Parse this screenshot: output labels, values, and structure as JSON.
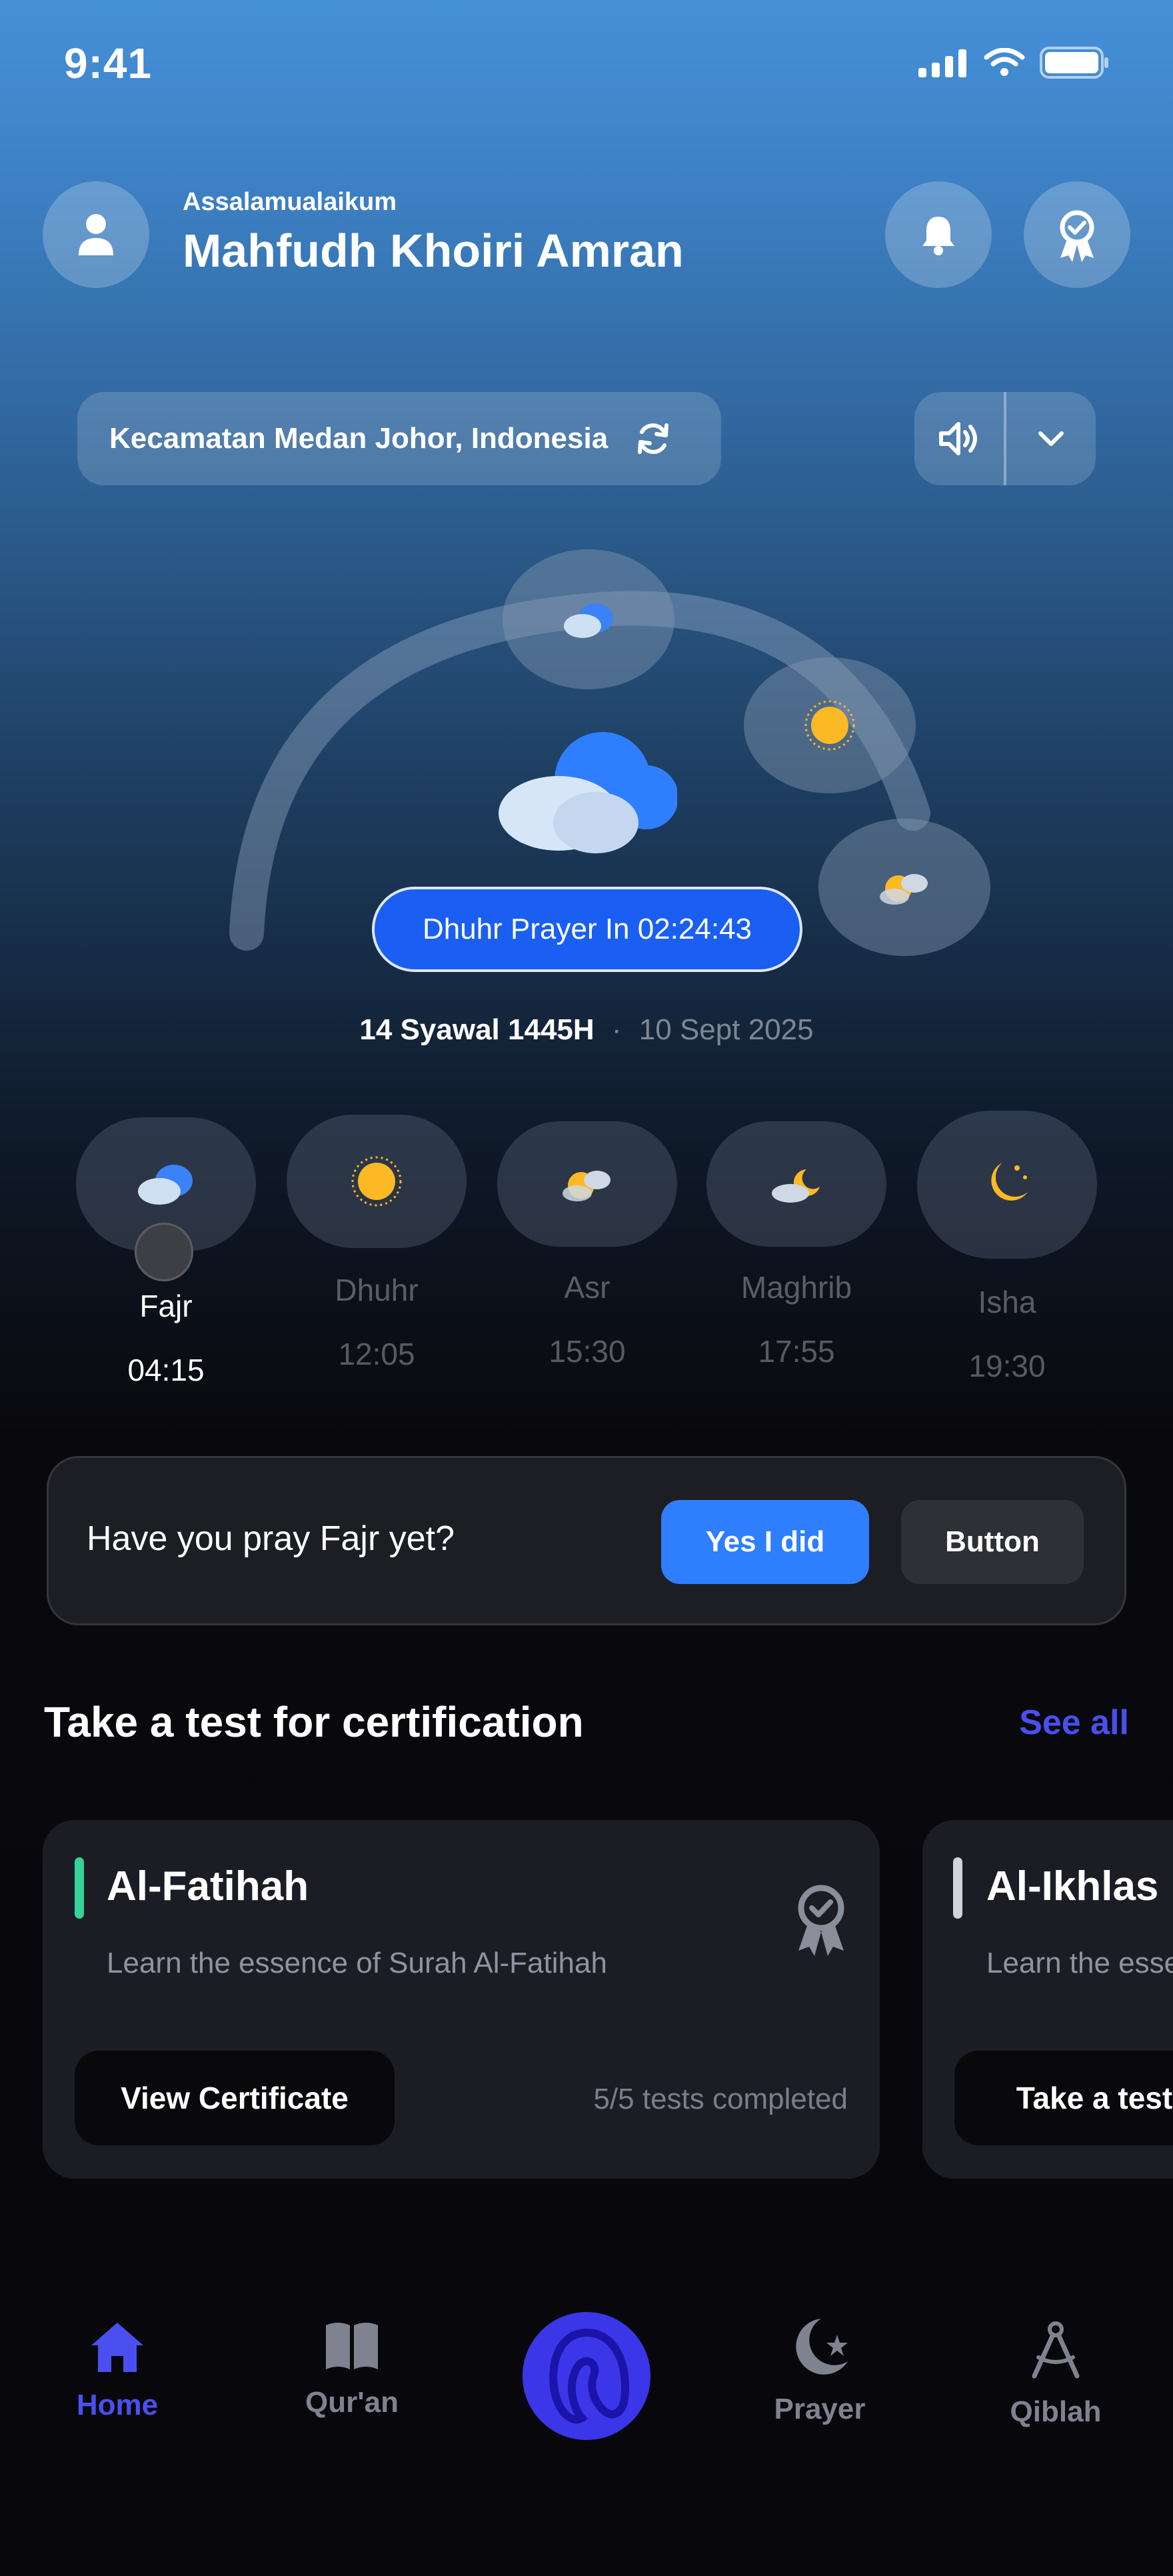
{
  "status_bar": {
    "time": "9:41",
    "signal_icon": "signal-bars-icon",
    "wifi_icon": "wifi-icon",
    "battery_icon": "battery-icon"
  },
  "header": {
    "greeting": "Assalamualaikum",
    "user_name": "Mahfudh Khoiri Amran",
    "avatar_icon": "user-icon",
    "notification_icon": "bell-icon",
    "badge_icon": "award-badge-icon"
  },
  "location": {
    "text": "Kecamatan Medan Johor, Indonesia",
    "refresh_icon": "refresh-icon",
    "sound_icon": "speaker-icon",
    "dropdown_icon": "chevron-down-icon"
  },
  "countdown": {
    "label": "Dhuhr Prayer In 02:24:43"
  },
  "date": {
    "hijri": "14 Syawal 1445H",
    "separator": "·",
    "gregorian": "10 Sept 2025"
  },
  "prayers": [
    {
      "name": "Fajr",
      "time": "04:15",
      "icon": "cloud-icon",
      "active": true
    },
    {
      "name": "Dhuhr",
      "time": "12:05",
      "icon": "sun-icon",
      "active": false
    },
    {
      "name": "Asr",
      "time": "15:30",
      "icon": "partly-cloudy-icon",
      "active": false
    },
    {
      "name": "Maghrib",
      "time": "17:55",
      "icon": "cloud-moon-icon",
      "active": false
    },
    {
      "name": "Isha",
      "time": "19:30",
      "icon": "moon-stars-icon",
      "active": false
    }
  ],
  "question": {
    "text": "Have you pray Fajr yet?",
    "yes_label": "Yes I did",
    "alt_label": "Button"
  },
  "certification": {
    "title": "Take a test for certification",
    "see_all": "See all",
    "cards": [
      {
        "title": "Al-Fatihah",
        "description": "Learn the essence of Surah Al-Fatihah",
        "button": "View Certificate",
        "progress": "5/5 tests completed",
        "accent": "#34d399",
        "icon": "award-ribbon-icon"
      },
      {
        "title": "Al-Ikhlas",
        "description": "Learn the essence of Surah Al-Ikhlas",
        "button": "Take a test",
        "progress": "",
        "accent": "#d1d5db"
      }
    ]
  },
  "nav": {
    "items": [
      {
        "label": "Home",
        "icon": "home-icon",
        "active": true
      },
      {
        "label": "Qur'an",
        "icon": "book-icon",
        "active": false
      },
      {
        "label": "Prayer",
        "icon": "crescent-star-icon",
        "active": false
      },
      {
        "label": "Qiblah",
        "icon": "compass-icon",
        "active": false
      }
    ],
    "center_icon": "app-logo-icon"
  },
  "colors": {
    "accent": "#1a5ff2",
    "link": "#4a4ff0",
    "yes_button": "#2f7efe",
    "sun": "#fbb924"
  }
}
